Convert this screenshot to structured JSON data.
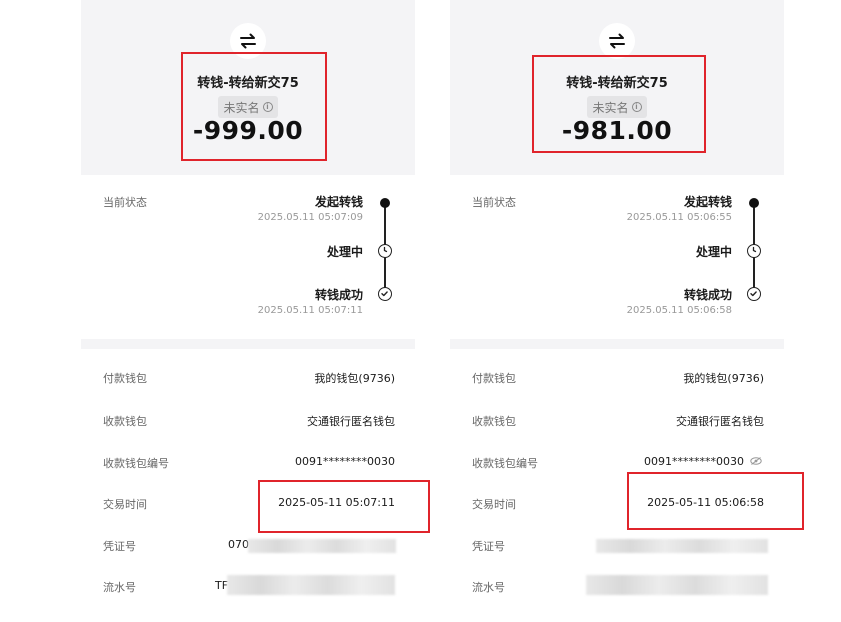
{
  "panels": [
    {
      "title": "转钱-转给新交75",
      "badge": "未实名",
      "amount": "-999.00",
      "status_label": "当前状态",
      "steps": [
        {
          "title": "发起转钱",
          "time": "2025.05.11 05:07:09"
        },
        {
          "title": "处理中",
          "time": ""
        },
        {
          "title": "转钱成功",
          "time": "2025.05.11 05:07:11"
        }
      ],
      "rows": [
        {
          "label": "付款钱包",
          "value": "我的钱包(9736)"
        },
        {
          "label": "收款钱包",
          "value": "交通银行匿名钱包"
        },
        {
          "label": "收款钱包编号",
          "value": "0091********0030"
        },
        {
          "label": "交易时间",
          "value": "2025-05-11 05:07:11"
        },
        {
          "label": "凭证号",
          "value": "070"
        },
        {
          "label": "流水号",
          "value": "TF"
        }
      ]
    },
    {
      "title": "转钱-转给新交75",
      "badge": "未实名",
      "amount": "-981.00",
      "status_label": "当前状态",
      "steps": [
        {
          "title": "发起转钱",
          "time": "2025.05.11 05:06:55"
        },
        {
          "title": "处理中",
          "time": ""
        },
        {
          "title": "转钱成功",
          "time": "2025.05.11 05:06:58"
        }
      ],
      "rows": [
        {
          "label": "付款钱包",
          "value": "我的钱包(9736)"
        },
        {
          "label": "收款钱包",
          "value": "交通银行匿名钱包"
        },
        {
          "label": "收款钱包编号",
          "value": "0091********0030"
        },
        {
          "label": "交易时间",
          "value": "2025-05-11 05:06:58"
        },
        {
          "label": "凭证号",
          "value": ""
        },
        {
          "label": "流水号",
          "value": ""
        }
      ]
    }
  ],
  "colors": {
    "highlight": "#e0242b",
    "header_bg": "#f4f4f6"
  },
  "icons": {
    "header": "swap-arrows-icon",
    "badge": "info-icon",
    "timeline": [
      "start-dot-icon",
      "clock-icon",
      "check-circle-icon"
    ],
    "wallet_number": "eye-hidden-icon"
  }
}
